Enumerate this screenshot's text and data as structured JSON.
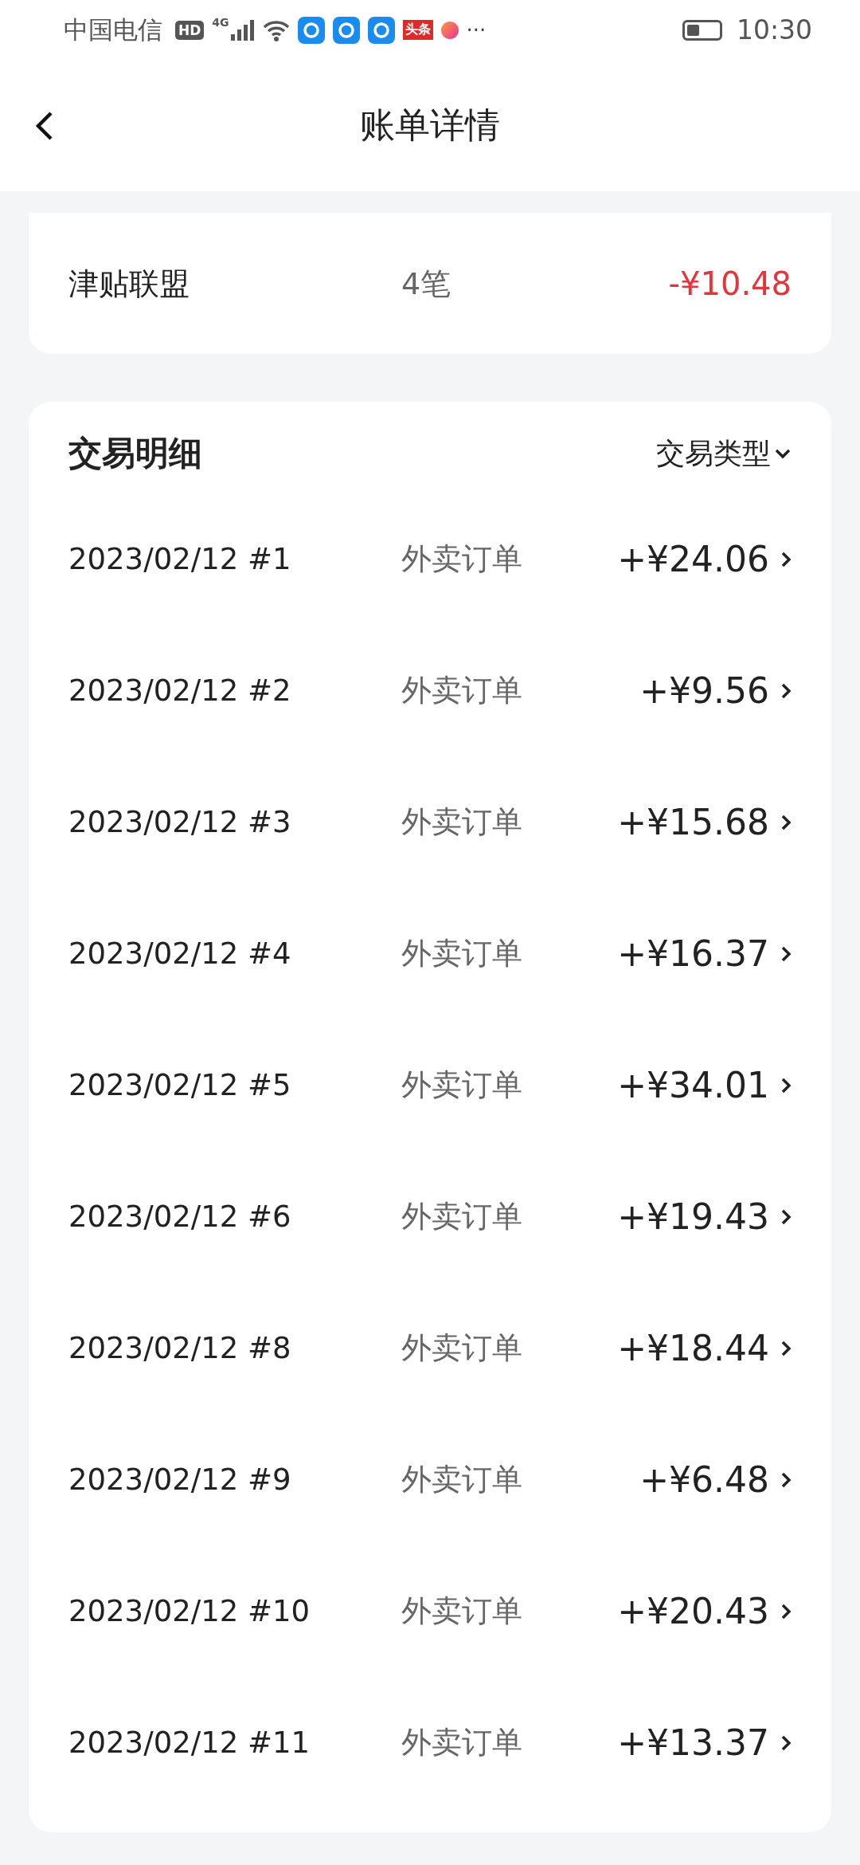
{
  "status_bar": {
    "carrier": "中国电信",
    "hd_badge": "HD",
    "network": "4G",
    "app_badge": "头条",
    "more": "···",
    "time": "10:30"
  },
  "header": {
    "title": "账单详情"
  },
  "summary": {
    "rows": [
      {
        "name": "津贴联盟",
        "count": "4笔",
        "amount": "-¥10.48",
        "kind": "expense"
      }
    ]
  },
  "transactions": {
    "title": "交易明细",
    "filter": "交易类型",
    "rows": [
      {
        "date": "2023/02/12 #1",
        "type": "外卖订单",
        "amount": "+¥24.06"
      },
      {
        "date": "2023/02/12 #2",
        "type": "外卖订单",
        "amount": "+¥9.56"
      },
      {
        "date": "2023/02/12 #3",
        "type": "外卖订单",
        "amount": "+¥15.68"
      },
      {
        "date": "2023/02/12 #4",
        "type": "外卖订单",
        "amount": "+¥16.37"
      },
      {
        "date": "2023/02/12 #5",
        "type": "外卖订单",
        "amount": "+¥34.01"
      },
      {
        "date": "2023/02/12 #6",
        "type": "外卖订单",
        "amount": "+¥19.43"
      },
      {
        "date": "2023/02/12 #8",
        "type": "外卖订单",
        "amount": "+¥18.44"
      },
      {
        "date": "2023/02/12 #9",
        "type": "外卖订单",
        "amount": "+¥6.48"
      },
      {
        "date": "2023/02/12 #10",
        "type": "外卖订单",
        "amount": "+¥20.43"
      },
      {
        "date": "2023/02/12 #11",
        "type": "外卖订单",
        "amount": "+¥13.37"
      }
    ]
  }
}
